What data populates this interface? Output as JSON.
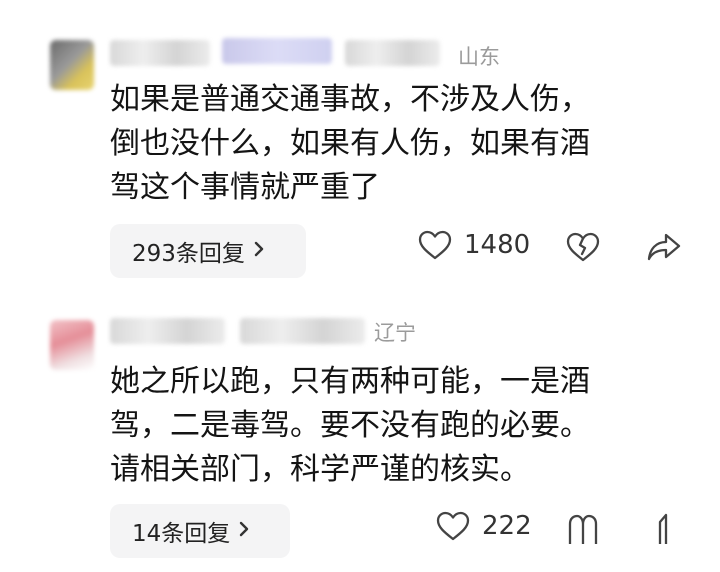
{
  "comments": [
    {
      "region": "山东",
      "content": "如果是普通交通事故，不涉及人伤，\n倒也没什么，如果有人伤，如果有酒\n驾这个事情就严重了",
      "replies_label": "293条回复",
      "likes": "1480"
    },
    {
      "region": "辽宁",
      "content": "她之所以跑，只有两种可能，一是酒\n驾，二是毒驾。要不没有跑的必要。\n请相关部门，科学严谨的核实。",
      "replies_label": "14条回复",
      "likes": "222"
    }
  ],
  "icons": [
    "avatar",
    "chevron-right-icon",
    "heart-icon",
    "broken-heart-icon",
    "share-icon"
  ]
}
